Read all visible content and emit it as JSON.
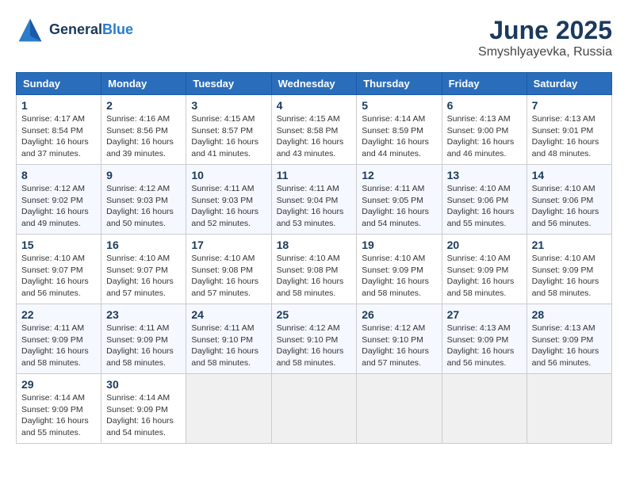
{
  "header": {
    "logo_line1": "General",
    "logo_line2": "Blue",
    "month": "June 2025",
    "location": "Smyshlyayevka, Russia"
  },
  "weekdays": [
    "Sunday",
    "Monday",
    "Tuesday",
    "Wednesday",
    "Thursday",
    "Friday",
    "Saturday"
  ],
  "weeks": [
    [
      {
        "day": "1",
        "sunrise": "4:17 AM",
        "sunset": "8:54 PM",
        "daylight": "16 hours and 37 minutes."
      },
      {
        "day": "2",
        "sunrise": "4:16 AM",
        "sunset": "8:56 PM",
        "daylight": "16 hours and 39 minutes."
      },
      {
        "day": "3",
        "sunrise": "4:15 AM",
        "sunset": "8:57 PM",
        "daylight": "16 hours and 41 minutes."
      },
      {
        "day": "4",
        "sunrise": "4:15 AM",
        "sunset": "8:58 PM",
        "daylight": "16 hours and 43 minutes."
      },
      {
        "day": "5",
        "sunrise": "4:14 AM",
        "sunset": "8:59 PM",
        "daylight": "16 hours and 44 minutes."
      },
      {
        "day": "6",
        "sunrise": "4:13 AM",
        "sunset": "9:00 PM",
        "daylight": "16 hours and 46 minutes."
      },
      {
        "day": "7",
        "sunrise": "4:13 AM",
        "sunset": "9:01 PM",
        "daylight": "16 hours and 48 minutes."
      }
    ],
    [
      {
        "day": "8",
        "sunrise": "4:12 AM",
        "sunset": "9:02 PM",
        "daylight": "16 hours and 49 minutes."
      },
      {
        "day": "9",
        "sunrise": "4:12 AM",
        "sunset": "9:03 PM",
        "daylight": "16 hours and 50 minutes."
      },
      {
        "day": "10",
        "sunrise": "4:11 AM",
        "sunset": "9:03 PM",
        "daylight": "16 hours and 52 minutes."
      },
      {
        "day": "11",
        "sunrise": "4:11 AM",
        "sunset": "9:04 PM",
        "daylight": "16 hours and 53 minutes."
      },
      {
        "day": "12",
        "sunrise": "4:11 AM",
        "sunset": "9:05 PM",
        "daylight": "16 hours and 54 minutes."
      },
      {
        "day": "13",
        "sunrise": "4:10 AM",
        "sunset": "9:06 PM",
        "daylight": "16 hours and 55 minutes."
      },
      {
        "day": "14",
        "sunrise": "4:10 AM",
        "sunset": "9:06 PM",
        "daylight": "16 hours and 56 minutes."
      }
    ],
    [
      {
        "day": "15",
        "sunrise": "4:10 AM",
        "sunset": "9:07 PM",
        "daylight": "16 hours and 56 minutes."
      },
      {
        "day": "16",
        "sunrise": "4:10 AM",
        "sunset": "9:07 PM",
        "daylight": "16 hours and 57 minutes."
      },
      {
        "day": "17",
        "sunrise": "4:10 AM",
        "sunset": "9:08 PM",
        "daylight": "16 hours and 57 minutes."
      },
      {
        "day": "18",
        "sunrise": "4:10 AM",
        "sunset": "9:08 PM",
        "daylight": "16 hours and 58 minutes."
      },
      {
        "day": "19",
        "sunrise": "4:10 AM",
        "sunset": "9:09 PM",
        "daylight": "16 hours and 58 minutes."
      },
      {
        "day": "20",
        "sunrise": "4:10 AM",
        "sunset": "9:09 PM",
        "daylight": "16 hours and 58 minutes."
      },
      {
        "day": "21",
        "sunrise": "4:10 AM",
        "sunset": "9:09 PM",
        "daylight": "16 hours and 58 minutes."
      }
    ],
    [
      {
        "day": "22",
        "sunrise": "4:11 AM",
        "sunset": "9:09 PM",
        "daylight": "16 hours and 58 minutes."
      },
      {
        "day": "23",
        "sunrise": "4:11 AM",
        "sunset": "9:09 PM",
        "daylight": "16 hours and 58 minutes."
      },
      {
        "day": "24",
        "sunrise": "4:11 AM",
        "sunset": "9:10 PM",
        "daylight": "16 hours and 58 minutes."
      },
      {
        "day": "25",
        "sunrise": "4:12 AM",
        "sunset": "9:10 PM",
        "daylight": "16 hours and 58 minutes."
      },
      {
        "day": "26",
        "sunrise": "4:12 AM",
        "sunset": "9:10 PM",
        "daylight": "16 hours and 57 minutes."
      },
      {
        "day": "27",
        "sunrise": "4:13 AM",
        "sunset": "9:09 PM",
        "daylight": "16 hours and 56 minutes."
      },
      {
        "day": "28",
        "sunrise": "4:13 AM",
        "sunset": "9:09 PM",
        "daylight": "16 hours and 56 minutes."
      }
    ],
    [
      {
        "day": "29",
        "sunrise": "4:14 AM",
        "sunset": "9:09 PM",
        "daylight": "16 hours and 55 minutes."
      },
      {
        "day": "30",
        "sunrise": "4:14 AM",
        "sunset": "9:09 PM",
        "daylight": "16 hours and 54 minutes."
      },
      null,
      null,
      null,
      null,
      null
    ]
  ]
}
